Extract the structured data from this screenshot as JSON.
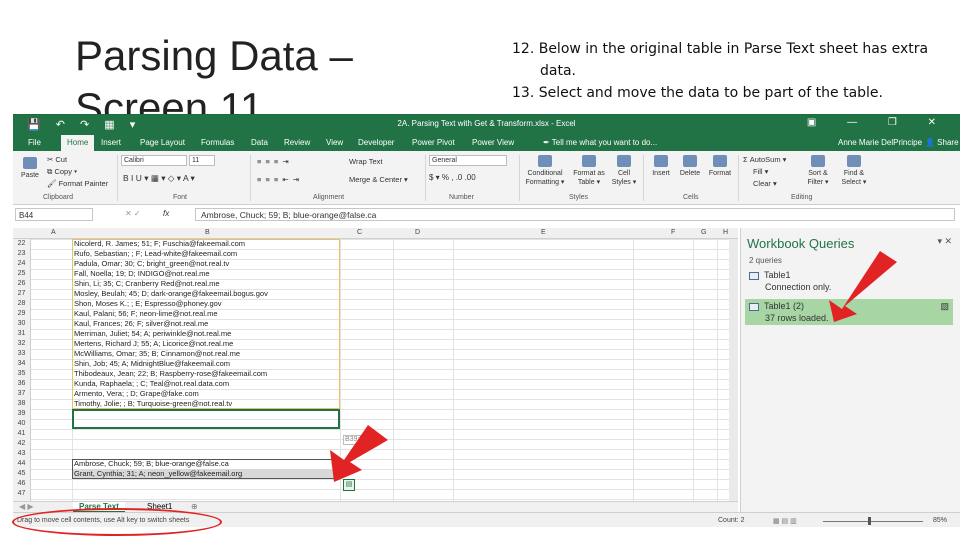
{
  "slide": {
    "title": "Parsing Data – Screen 11",
    "steps": [
      "12. Below in the original table in Parse Text sheet has extra data.",
      "13. Select and move the data to be part of the table."
    ]
  },
  "excel": {
    "window_title": "2A. Parsing Text with Get & Transform.xlsx - Excel",
    "quick_access": "💾 ↶ ↷ ▦ ▾",
    "window_buttons": "▣ — ❐ ✕",
    "tabs": [
      "File",
      "Home",
      "Insert",
      "Page Layout",
      "Formulas",
      "Data",
      "Review",
      "View",
      "Developer",
      "Power Pivot",
      "Power View"
    ],
    "tell_me": "✒ Tell me what you want to do...",
    "user": "Anne Marie DelPrincipe",
    "share": "👤 Share",
    "ribbon": {
      "paste": "Paste",
      "cut": "✂ Cut",
      "copy": "⧉ Copy ▾",
      "format_painter": "🖌 Format Painter",
      "font_name": "Calibri",
      "font_size": "11",
      "font_format": "B  I  U ▾  ▦ ▾  ◇ ▾  A ▾",
      "wrap_text": "Wrap Text",
      "merge_center": "Merge & Center ▾",
      "number_format": "General",
      "number_symbols": "$ ▾ % ,  .0  .00",
      "conditional_formatting": "Conditional Formatting ▾",
      "format_as_table": "Format as Table ▾",
      "cell_styles": "Cell Styles ▾",
      "insert": "Insert",
      "delete": "Delete",
      "format": "Format",
      "autosum": "Σ AutoSum ▾",
      "fill": "Fill ▾",
      "clear": "Clear ▾",
      "sort_filter": "Sort & Filter ▾",
      "find_select": "Find & Select ▾",
      "groups": [
        "Clipboard",
        "Font",
        "Alignment",
        "Number",
        "Styles",
        "Cells",
        "Editing"
      ]
    },
    "name_box": "B44",
    "fx": "fx",
    "formula": "Ambrose, Chuck; 59; B; blue-orange@false.ca",
    "columns": [
      "A",
      "B",
      "C",
      "D",
      "E",
      "F",
      "G",
      "H"
    ],
    "row_numbers": [
      "22",
      "23",
      "24",
      "25",
      "26",
      "27",
      "28",
      "29",
      "30",
      "31",
      "32",
      "33",
      "34",
      "35",
      "36",
      "37",
      "38",
      "39",
      "40",
      "41",
      "42",
      "43",
      "44",
      "45",
      "46",
      "47"
    ],
    "rows": [
      "Nicolerd, R. James; 51; F; Fuschia@fakeemail.com",
      "Rufo, Sebastian; ; F; Lead-white@fakeemail.com",
      "Padula, Omar; 30; C; bright_green@not.real.tv",
      "Fall, Noella; 19; D; INDIGO@not.real.me",
      "Shin, Li; 35; C; Cranberry Red@not.real.me",
      "Mosley, Beulah; 45; D; dark-orange@fakeemail.bogus.gov",
      "Shon, Moses K.; ; E; Espresso@phoney.gov",
      "Kaul, Palani; 56; F; neon-lime@not.real.me",
      "Kaul, Frances; 26; F; silver@not.real.me",
      "Merriman, Juliet; 54; A; periwinkle@not.real.me",
      "Mertens, Richard J; 55; A; Licorice@not.real.me",
      "McWilliams, Omar; 35; B; Cinnamon@not.real.me",
      "Shin, Job; 45; A; MidnightBlue@fakeemail.com",
      "Thibodeaux, Jean; 22; B; Raspberry-rose@fakeemail.com",
      "Kunda, Raphaela; ; C; Teal@not.real.data.com",
      "Armento, Vera; ; D; Grape@fake.com",
      "Timothy, Jolie; ; B; Turquoise-green@not.real.tv"
    ],
    "moved_rows": [
      "Ambrose, Chuck; 59; B; blue-orange@false.ca",
      "Grant, Cynthia; 31; A; neon_yellow@fakeemail.org"
    ],
    "tooltip": "B39:B",
    "sheet_tabs": [
      "Parse Text",
      "Sheet1",
      "⊕"
    ],
    "status_text": "Drag to move cell contents, use Alt key to switch sheets",
    "status_count": "Count: 2",
    "zoom": "85%",
    "queries": {
      "title": "Workbook Queries",
      "controls": "▾ ✕",
      "count": "2 queries",
      "items": [
        {
          "name": "Table1",
          "status": "Connection only."
        },
        {
          "name": "Table1 (2)",
          "status": "37 rows loaded."
        }
      ]
    }
  },
  "colors": {
    "excel_green": "#217346",
    "annotation_red": "#e12323",
    "selected_query": "#a7d6a4"
  }
}
